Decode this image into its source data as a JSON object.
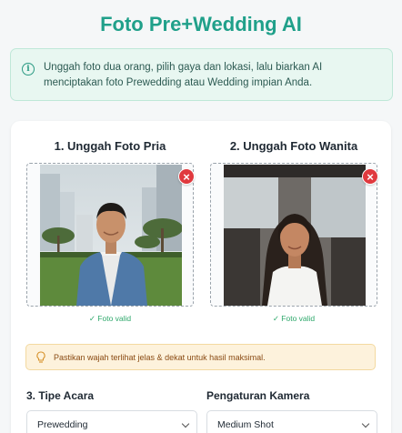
{
  "app": {
    "title": "Foto Pre+Wedding AI"
  },
  "info": {
    "icon": "info-icon",
    "line1": "Unggah foto dua orang, pilih gaya dan lokasi, lalu biarkan AI",
    "line2": "menciptakan foto Prewedding atau Wedding impian Anda."
  },
  "upload_groom": {
    "title": "1. Unggah Foto Pria",
    "remove_icon": "×",
    "status": "✓ Foto valid"
  },
  "upload_bride": {
    "title": "2. Unggah Foto Wanita",
    "remove_icon": "×",
    "status": "✓ Foto valid"
  },
  "tip": {
    "icon": "lightbulb-icon",
    "text": "Pastikan wajah terlihat jelas & dekat untuk hasil maksimal."
  },
  "event_type": {
    "label": "3. Tipe Acara",
    "value": "Prewedding"
  },
  "camera": {
    "label": "Pengaturan Kamera",
    "value": "Medium Shot"
  },
  "colors": {
    "accent": "#20a08a",
    "error": "#e0393e",
    "valid": "#2ea86b",
    "warning_bg": "#fdf2dc"
  }
}
